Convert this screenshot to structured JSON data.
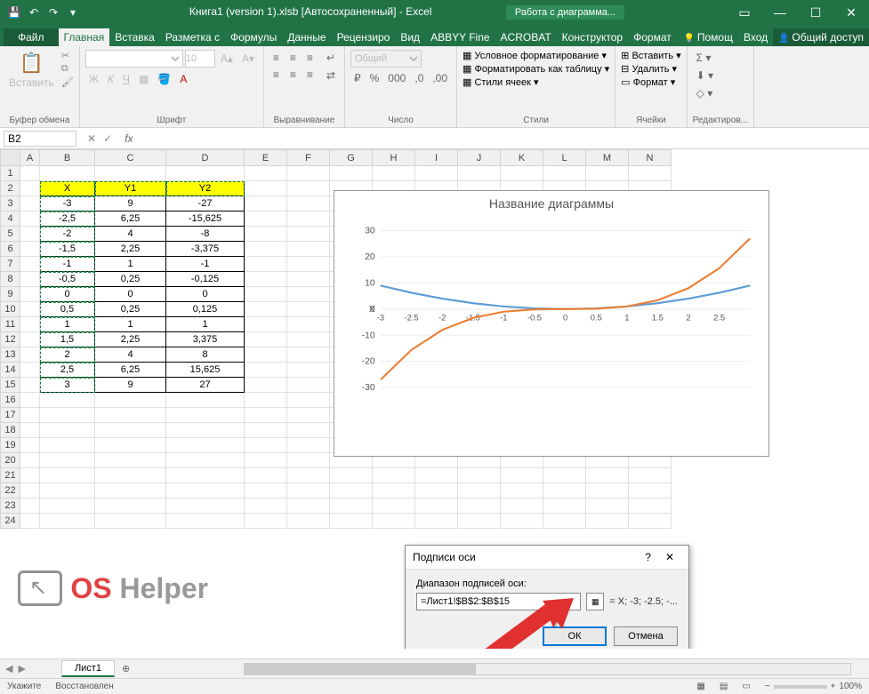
{
  "title": {
    "doc": "Книга1 (version 1).xlsb [Автосохраненный] - Excel",
    "context": "Работа с диаграмма..."
  },
  "tabs": {
    "file": "Файл",
    "items": [
      "Главная",
      "Вставка",
      "Разметка с",
      "Формулы",
      "Данные",
      "Рецензиро",
      "Вид",
      "ABBYY Fine",
      "ACROBAT",
      "Конструктор",
      "Формат"
    ],
    "active": 0,
    "help": "Помощ",
    "login": "Вход",
    "share": "Общий доступ"
  },
  "ribbon": {
    "clipboard": {
      "paste": "Вставить",
      "label": "Буфер обмена"
    },
    "font": {
      "label": "Шрифт",
      "size": "10"
    },
    "align": {
      "label": "Выравнивание"
    },
    "number": {
      "format": "Общий",
      "label": "Число"
    },
    "styles": {
      "cond": "Условное форматирование",
      "table": "Форматировать как таблицу",
      "cell": "Стили ячеек",
      "label": "Стили"
    },
    "cells": {
      "insert": "Вставить",
      "delete": "Удалить",
      "format": "Формат",
      "label": "Ячейки"
    },
    "editing": {
      "label": "Редактиров..."
    }
  },
  "formula_bar": {
    "name_box": "B2",
    "formula": ""
  },
  "columns": [
    "A",
    "B",
    "C",
    "D",
    "E",
    "F",
    "G",
    "H",
    "I",
    "J",
    "K",
    "L",
    "M",
    "N"
  ],
  "data_table": {
    "headers": [
      "X",
      "Y1",
      "Y2"
    ],
    "rows": [
      [
        "-3",
        "9",
        "-27"
      ],
      [
        "-2,5",
        "6,25",
        "-15,625"
      ],
      [
        "-2",
        "4",
        "-8"
      ],
      [
        "-1,5",
        "2,25",
        "-3,375"
      ],
      [
        "-1",
        "1",
        "-1"
      ],
      [
        "-0,5",
        "0,25",
        "-0,125"
      ],
      [
        "0",
        "0",
        "0"
      ],
      [
        "0,5",
        "0,25",
        "0,125"
      ],
      [
        "1",
        "1",
        "1"
      ],
      [
        "1,5",
        "2,25",
        "3,375"
      ],
      [
        "2",
        "4",
        "8"
      ],
      [
        "2,5",
        "6,25",
        "15,625"
      ],
      [
        "3",
        "9",
        "27"
      ]
    ],
    "row_start": 2
  },
  "chart_data": {
    "type": "line",
    "title": "Название диаграммы",
    "x": [
      -3,
      -2.5,
      -2,
      -1.5,
      -1,
      -0.5,
      0,
      0.5,
      1,
      1.5,
      2,
      2.5,
      3
    ],
    "series": [
      {
        "name": "Y1",
        "values": [
          9,
          6.25,
          4,
          2.25,
          1,
          0.25,
          0,
          0.25,
          1,
          2.25,
          4,
          6.25,
          9
        ],
        "color": "#5b9bd5"
      },
      {
        "name": "Y2",
        "values": [
          -27,
          -15.625,
          -8,
          -3.375,
          -1,
          -0.125,
          0,
          0.125,
          1,
          3.375,
          8,
          15.625,
          27
        ],
        "color": "#ed7d31"
      }
    ],
    "y_ticks": [
      -30,
      -20,
      -10,
      0,
      10,
      20,
      30
    ],
    "x_label_prefix": "X",
    "x_ticks": [
      "-3",
      "-2.5",
      "-2",
      "-1.5",
      "-1",
      "-0.5",
      "0",
      "0.5",
      "1",
      "1.5",
      "2",
      "2.5"
    ],
    "ylim": [
      -30,
      30
    ]
  },
  "dialog": {
    "title": "Подписи оси",
    "label": "Диапазон подписей оси:",
    "value": "=Лист1!$B$2:$B$15",
    "preview": "= X; -3; -2.5; -...",
    "ok": "ОК",
    "cancel": "Отмена"
  },
  "sheet": {
    "name": "Лист1"
  },
  "status": {
    "mode": "Укажите",
    "recovered": "Восстановлен",
    "zoom": "100%"
  },
  "watermark": {
    "p1": "OS",
    "p2": "Helper"
  }
}
